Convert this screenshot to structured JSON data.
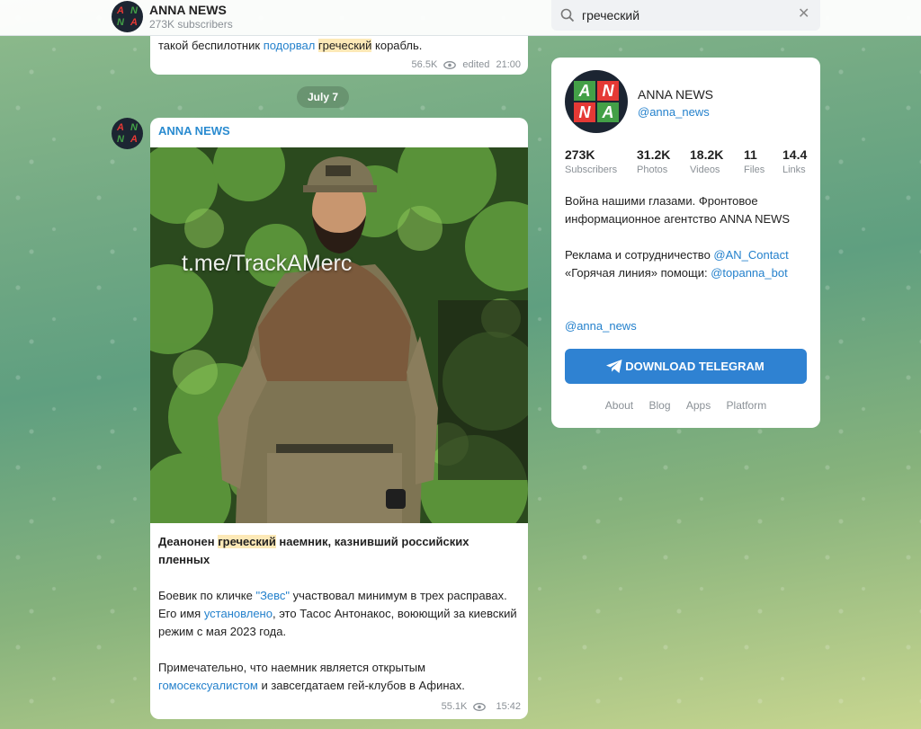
{
  "header": {
    "channel_title": "ANNA NEWS",
    "channel_subscribers": "273K subscribers",
    "search_value": "греческий",
    "search_placeholder": "Search",
    "logo_letters": [
      "A",
      "N",
      "N",
      "A"
    ]
  },
  "prev_message": {
    "text_before": "такой беспилотник ",
    "link": "подорвал",
    "text_between": " ",
    "highlight": "греческий",
    "text_after": " корабль.",
    "views": "56.5K",
    "edited": "edited",
    "time": "21:00"
  },
  "date_pill": "July 7",
  "message": {
    "author": "ANNA NEWS",
    "photo_watermark": "t.me/TrackAMerc",
    "headline_before": "Деанонен ",
    "headline_highlight": "греческий",
    "headline_after": " наемник, казнивший российских пленных",
    "p1_a": "Боевик по кличке ",
    "p1_link": "\"Зевс\"",
    "p1_b": " участвовал минимум в трех расправах. Его имя ",
    "p1_link2": "установлено",
    "p1_c": ", это Тасос Антонакос, воюющий за киевский режим с мая 2023 года.",
    "p2_a": "Примечательно, что наемник является открытым ",
    "p2_link": "гомосексуалистом",
    "p2_b": " и завсегдатаем гей-клубов в Афинах.",
    "views": "55.1K",
    "time": "15:42"
  },
  "card": {
    "name": "ANNA NEWS",
    "handle": "@anna_news",
    "stats": [
      {
        "value": "273K",
        "label": "Subscribers"
      },
      {
        "value": "31.2K",
        "label": "Photos"
      },
      {
        "value": "18.2K",
        "label": "Videos"
      },
      {
        "value": "11",
        "label": "Files"
      },
      {
        "value": "14.4",
        "label": "Links"
      }
    ],
    "desc1": "Война нашими глазами. Фронтовое информационное агентство ANNA NEWS",
    "desc2_a": "Реклама и сотрудничество ",
    "desc2_link": "@AN_Contact",
    "desc2_b": "«Горячая линия» помощи: ",
    "desc2_link2": "@topanna_bot",
    "bottom_handle": "@anna_news",
    "download_label": "DOWNLOAD TELEGRAM",
    "footer": [
      "About",
      "Blog",
      "Apps",
      "Platform"
    ]
  },
  "colors": {
    "accent": "#2481cc",
    "button": "#2f82d2",
    "highlight": "#fde9b7",
    "logo_red": "#d32f2f",
    "logo_green": "#3aa23a"
  },
  "icons": {
    "search": "search-icon",
    "clear": "close-icon",
    "views": "eye-icon",
    "telegram": "telegram-plane-icon"
  }
}
